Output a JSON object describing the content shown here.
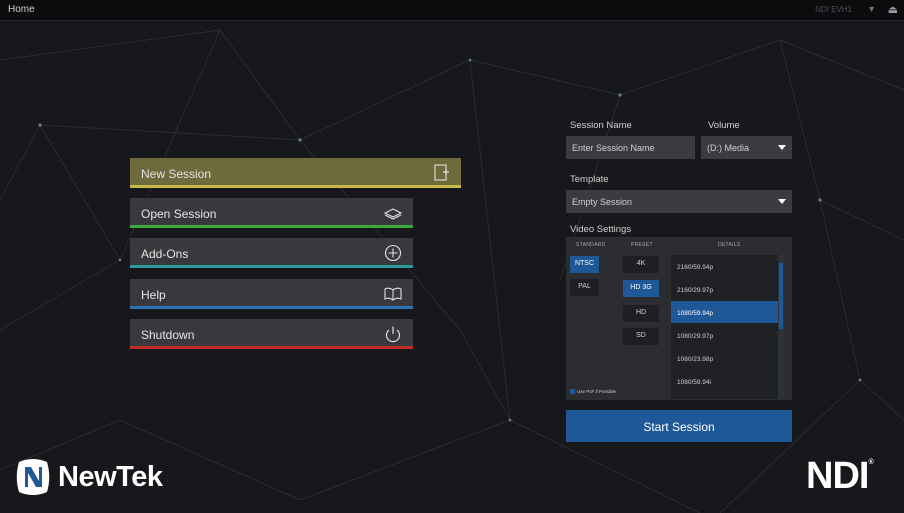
{
  "window": {
    "title": "Home",
    "system_name": "NDI EVH1"
  },
  "menu": [
    {
      "label": "New Session",
      "icon": "new-session-icon",
      "accent": "#c9b94a"
    },
    {
      "label": "Open Session",
      "icon": "open-session-icon",
      "accent": "#3ca83c"
    },
    {
      "label": "Add-Ons",
      "icon": "add-ons-icon",
      "accent": "#2b9a9a"
    },
    {
      "label": "Help",
      "icon": "help-book-icon",
      "accent": "#2f6fb8"
    },
    {
      "label": "Shutdown",
      "icon": "power-icon",
      "accent": "#c42a2a"
    }
  ],
  "session": {
    "name_label": "Session Name",
    "name_placeholder": "Enter Session Name",
    "volume_label": "Volume",
    "volume_value": "(D:)  Media",
    "template_label": "Template",
    "template_value": "Empty Session"
  },
  "video_settings": {
    "label": "Video Settings",
    "standard_header": "STANDARD",
    "preset_header": "PRESET",
    "details_header": "DETAILS",
    "standards": [
      "NTSC",
      "PAL"
    ],
    "selected_standard": "NTSC",
    "presets": [
      "4K",
      "HD 3G",
      "HD",
      "SD"
    ],
    "selected_preset": "HD 3G",
    "details": [
      "2160/59.94p",
      "2160/29.97p",
      "1080/59.94p",
      "1080/29.97p",
      "1080/23.98p",
      "1080/59.94i"
    ],
    "selected_detail": "1080/59.94p",
    "use_psf_label": "Use PsF if Possible",
    "use_psf_checked": true
  },
  "start_label": "Start Session",
  "branding": {
    "left_logo": "NewTek",
    "right_logo": "NDI"
  },
  "colors": {
    "accent_blue": "#1f5896",
    "background": "#16181b"
  }
}
